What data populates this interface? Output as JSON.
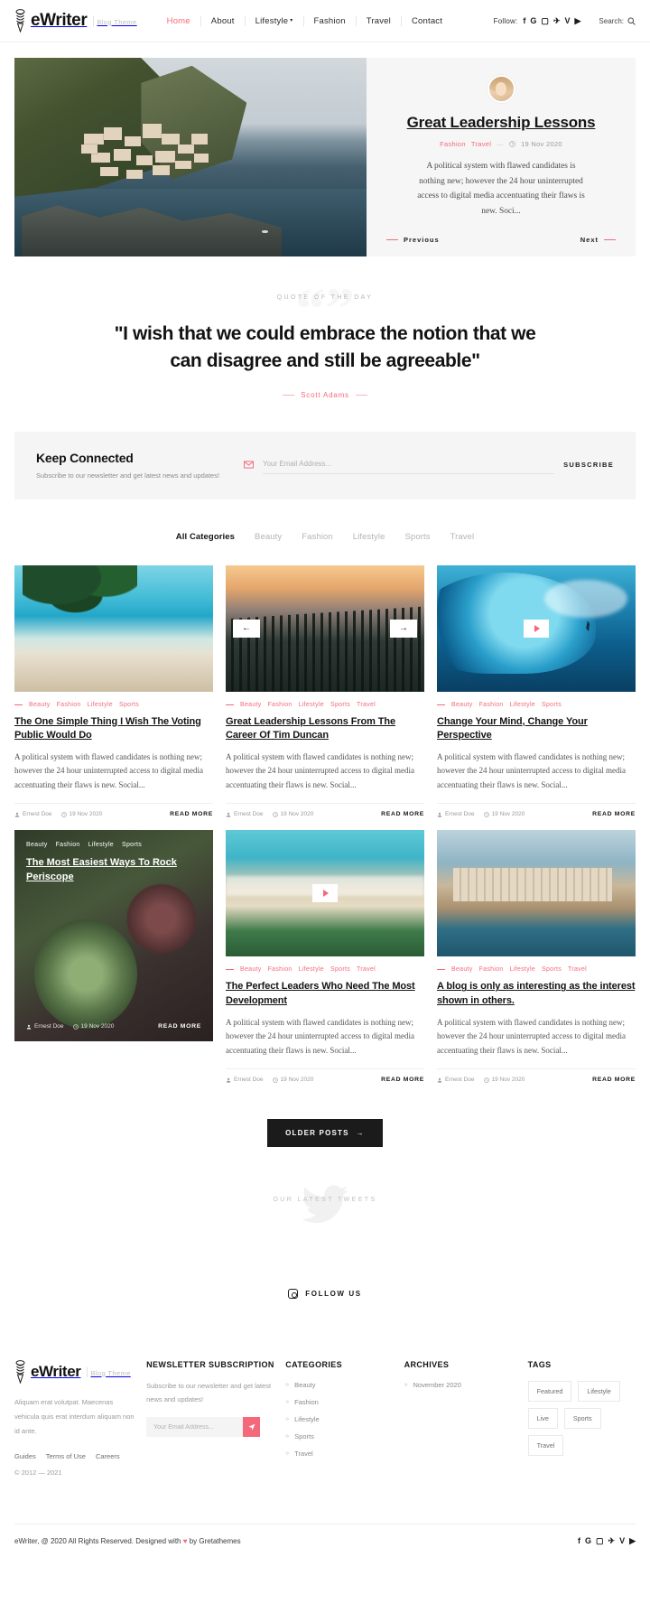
{
  "header": {
    "brand": {
      "name": "eWriter",
      "tagline": "Blog Theme",
      "mark_icon": "dna-pen-icon"
    },
    "nav": [
      {
        "label": "Home",
        "active": true
      },
      {
        "label": "About",
        "active": false
      },
      {
        "label": "Lifestyle",
        "active": false,
        "has_dropdown": true
      },
      {
        "label": "Fashion",
        "active": false
      },
      {
        "label": "Travel",
        "active": false
      },
      {
        "label": "Contact",
        "active": false
      }
    ],
    "follow_label": "Follow:",
    "social": [
      "facebook-icon",
      "google-icon",
      "instagram-icon",
      "twitter-icon",
      "vimeo-icon",
      "youtube-icon"
    ],
    "social_glyphs": [
      "f",
      "G",
      "▢",
      "✈",
      "V",
      "▶"
    ],
    "search_label": "Search:",
    "search_icon": "search-icon"
  },
  "hero": {
    "image_alt": "cliffside-village-by-the-sea",
    "avatar_alt": "author-avatar",
    "title": "Great Leadership Lessons",
    "categories": [
      "Fashion",
      "Travel"
    ],
    "date": "19 Nov 2020",
    "excerpt": "A political system with flawed candidates is nothing new; however the 24 hour uninterrupted access to digital media accentuating their flaws is new. Soci...",
    "prev_label": "Previous",
    "next_label": "Next"
  },
  "quote": {
    "kicker": "QUOTE OF THE DAY",
    "text": "\"I wish that we could embrace the notion that we can disagree and still be agreeable\"",
    "author": "Scott Adams",
    "watermark": "“”"
  },
  "connect": {
    "title": "Keep Connected",
    "subtitle": "Subscribe to our newsletter and get latest news and updates!",
    "email_placeholder": "Your Email Address...",
    "email_value": "",
    "mail_icon": "mail-icon",
    "subscribe_label": "SUBSCRIBE"
  },
  "filters": [
    {
      "label": "All Categories",
      "active": true
    },
    {
      "label": "Beauty",
      "active": false
    },
    {
      "label": "Fashion",
      "active": false
    },
    {
      "label": "Lifestyle",
      "active": false
    },
    {
      "label": "Sports",
      "active": false
    },
    {
      "label": "Travel",
      "active": false
    }
  ],
  "posts": [
    {
      "thumb_class": "t-beach",
      "thumb_alt": "tropical-beach-with-palm",
      "categories": [
        "Beauty",
        "Fashion",
        "Lifestyle",
        "Sports"
      ],
      "title": "The One Simple Thing I Wish The Voting Public Would Do",
      "excerpt": "A political system with flawed candidates is nothing new; however the 24 hour uninterrupted access to digital media accentuating their flaws is new. Social...",
      "author": "Ernest Doe",
      "date": "19 Nov 2020",
      "read_more": "READ MORE",
      "overlay": false,
      "media_control": "none"
    },
    {
      "thumb_class": "t-forest",
      "thumb_alt": "pine-forest-at-dusk",
      "categories": [
        "Beauty",
        "Fashion",
        "Lifestyle",
        "Sports",
        "Travel"
      ],
      "title": "Great Leadership Lessons From The Career Of Tim Duncan",
      "excerpt": "A political system with flawed candidates is nothing new; however the 24 hour uninterrupted access to digital media accentuating their flaws is new. Social...",
      "author": "Ernest Doe",
      "date": "19 Nov 2020",
      "read_more": "READ MORE",
      "overlay": false,
      "media_control": "arrows"
    },
    {
      "thumb_class": "t-wave",
      "thumb_alt": "surfer-riding-big-wave",
      "categories": [
        "Beauty",
        "Fashion",
        "Lifestyle",
        "Sports"
      ],
      "title": "Change Your Mind, Change Your Perspective",
      "excerpt": "A political system with flawed candidates is nothing new; however the 24 hour uninterrupted access to digital media accentuating their flaws is new. Social...",
      "author": "Ernest Doe",
      "date": "19 Nov 2020",
      "read_more": "READ MORE",
      "overlay": false,
      "media_control": "play"
    },
    {
      "thumb_class": "t-succ",
      "thumb_alt": "succulent-plants-close-up",
      "categories": [
        "Beauty",
        "Fashion",
        "Lifestyle",
        "Sports"
      ],
      "title": "The Most Easiest Ways To Rock Periscope",
      "excerpt": "",
      "author": "Ernest Doe",
      "date": "19 Nov 2020",
      "read_more": "READ MORE",
      "overlay": true,
      "media_control": "none"
    },
    {
      "thumb_class": "t-sand",
      "thumb_alt": "sandy-beach-aerial",
      "categories": [
        "Beauty",
        "Fashion",
        "Lifestyle",
        "Sports",
        "Travel"
      ],
      "title": "The Perfect Leaders Who Need The Most Development",
      "excerpt": "A political system with flawed candidates is nothing new; however the 24 hour uninterrupted access to digital media accentuating their flaws is new. Social...",
      "author": "Ernest Doe",
      "date": "19 Nov 2020",
      "read_more": "READ MORE",
      "overlay": false,
      "media_control": "play"
    },
    {
      "thumb_class": "t-coast",
      "thumb_alt": "coastal-town-on-cliffs",
      "categories": [
        "Beauty",
        "Fashion",
        "Lifestyle",
        "Sports",
        "Travel"
      ],
      "title": "A blog is only as interesting as the interest shown in others.",
      "excerpt": "A political system with flawed candidates is nothing new; however the 24 hour uninterrupted access to digital media accentuating their flaws is new. Social...",
      "author": "Ernest Doe",
      "date": "19 Nov 2020",
      "read_more": "READ MORE",
      "overlay": false,
      "media_control": "none"
    }
  ],
  "older_posts": {
    "label": "OLDER POSTS",
    "arrow": "→"
  },
  "tweets": {
    "kicker": "OUR LATEST TWEETS",
    "watermark_icon": "twitter-bird-icon"
  },
  "followus": {
    "label": "FOLLOW US",
    "icon": "instagram-icon"
  },
  "footer": {
    "brand": {
      "name": "eWriter",
      "tagline": "Blog Theme",
      "mark_icon": "dna-pen-icon"
    },
    "about": "Aliquam erat volutpat. Maecenas vehicula quis erat interdum aliquam non id ante.",
    "links": [
      "Guides",
      "Terms of Use",
      "Careers"
    ],
    "copyright": "© 2012 — 2021",
    "newsletter": {
      "heading": "NEWSLETTER SUBSCRIPTION",
      "text": "Subscribe to our newsletter and get latest news and updates!",
      "placeholder": "Your Email Address...",
      "value": "",
      "submit_icon": "send-icon"
    },
    "categories": {
      "heading": "CATEGORIES",
      "items": [
        "Beauty",
        "Fashion",
        "Lifestyle",
        "Sports",
        "Travel"
      ]
    },
    "archives": {
      "heading": "ARCHIVES",
      "items": [
        "November 2020"
      ]
    },
    "tags": {
      "heading": "TAGS",
      "items": [
        "Featured",
        "Lifestyle",
        "Live",
        "Sports",
        "Travel"
      ]
    },
    "bottom_text": "eWriter, @ 2020 All Rights Reserved. Designed with ♥ by Gretathemes",
    "social_glyphs": [
      "f",
      "G",
      "▢",
      "✈",
      "V",
      "▶"
    ],
    "social": [
      "facebook-icon",
      "google-icon",
      "instagram-icon",
      "twitter-icon",
      "vimeo-icon",
      "youtube-icon"
    ]
  },
  "colors": {
    "accent": "#f4697a",
    "dark": "#1b1b1b",
    "muted": "#9a9a9a",
    "panel": "#f5f5f5"
  }
}
